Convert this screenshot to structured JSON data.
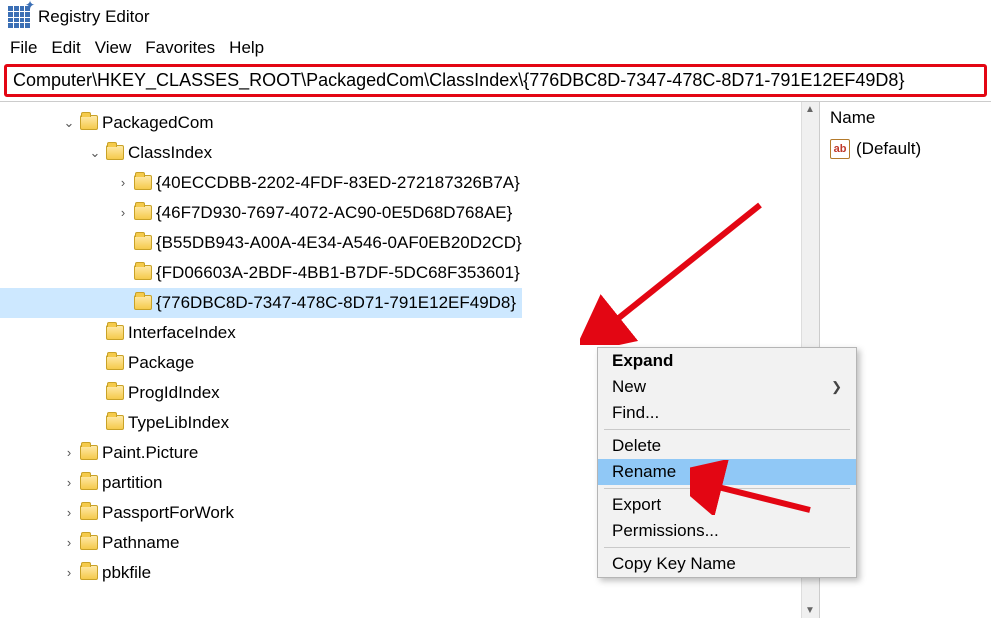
{
  "app": {
    "title": "Registry Editor"
  },
  "menu": {
    "file": "File",
    "edit": "Edit",
    "view": "View",
    "favorites": "Favorites",
    "help": "Help"
  },
  "address": {
    "value": "Computer\\HKEY_CLASSES_ROOT\\PackagedCom\\ClassIndex\\{776DBC8D-7347-478C-8D71-791E12EF49D8}"
  },
  "tree": [
    {
      "indent": 60,
      "chev": "down",
      "label": "PackagedCom"
    },
    {
      "indent": 86,
      "chev": "down",
      "label": "ClassIndex"
    },
    {
      "indent": 114,
      "chev": "right",
      "label": "{40ECCDBB-2202-4FDF-83ED-272187326B7A}"
    },
    {
      "indent": 114,
      "chev": "right",
      "label": "{46F7D930-7697-4072-AC90-0E5D68D768AE}"
    },
    {
      "indent": 114,
      "chev": "none",
      "label": "{B55DB943-A00A-4E34-A546-0AF0EB20D2CD}"
    },
    {
      "indent": 114,
      "chev": "none",
      "label": "{FD06603A-2BDF-4BB1-B7DF-5DC68F353601}"
    },
    {
      "indent": 114,
      "chev": "none",
      "label": "{776DBC8D-7347-478C-8D71-791E12EF49D8}",
      "selected": true
    },
    {
      "indent": 86,
      "chev": "none",
      "label": "InterfaceIndex"
    },
    {
      "indent": 86,
      "chev": "none",
      "label": "Package"
    },
    {
      "indent": 86,
      "chev": "none",
      "label": "ProgIdIndex"
    },
    {
      "indent": 86,
      "chev": "none",
      "label": "TypeLibIndex"
    },
    {
      "indent": 60,
      "chev": "right",
      "label": "Paint.Picture"
    },
    {
      "indent": 60,
      "chev": "right",
      "label": "partition"
    },
    {
      "indent": 60,
      "chev": "right",
      "label": "PassportForWork"
    },
    {
      "indent": 60,
      "chev": "right",
      "label": "Pathname"
    },
    {
      "indent": 60,
      "chev": "right",
      "label": "pbkfile"
    }
  ],
  "rightPane": {
    "columnName": "Name",
    "defaultValue": "(Default)"
  },
  "contextMenu": {
    "expand": "Expand",
    "new": "New",
    "find": "Find...",
    "delete": "Delete",
    "rename": "Rename",
    "export": "Export",
    "permissions": "Permissions...",
    "copyKeyName": "Copy Key Name"
  }
}
